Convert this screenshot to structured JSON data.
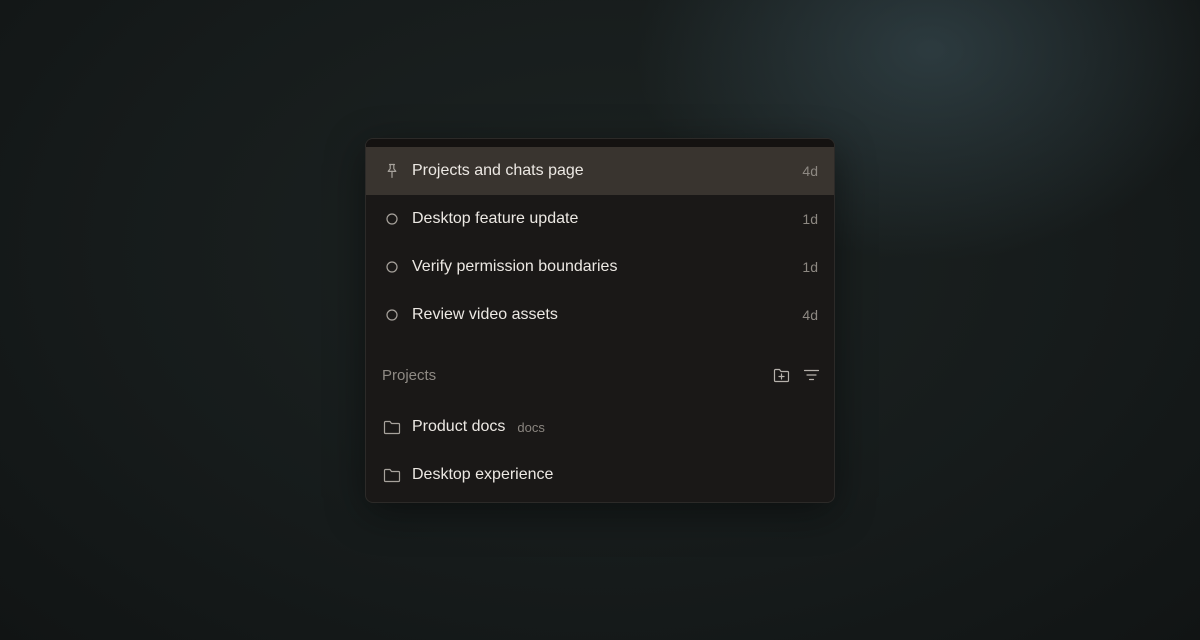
{
  "chats": [
    {
      "icon": "pin-icon",
      "title": "Projects and chats page",
      "age": "4d",
      "active": true
    },
    {
      "icon": "circle-icon",
      "title": "Desktop feature update",
      "age": "1d",
      "active": false
    },
    {
      "icon": "circle-icon",
      "title": "Verify permission boundaries",
      "age": "1d",
      "active": false
    },
    {
      "icon": "circle-icon",
      "title": "Review video assets",
      "age": "4d",
      "active": false
    }
  ],
  "projects_section": {
    "title": "Projects",
    "actions": [
      {
        "icon": "new-folder-icon"
      },
      {
        "icon": "filter-icon"
      }
    ]
  },
  "projects": [
    {
      "icon": "folder-icon",
      "name": "Product docs",
      "tag": "docs"
    },
    {
      "icon": "folder-icon",
      "name": "Desktop experience",
      "tag": ""
    }
  ],
  "colors": {
    "panel_bg": "#1a1817",
    "active_row_bg": "#39342f",
    "text_primary": "#ece8e3",
    "text_muted": "#8d8882"
  }
}
